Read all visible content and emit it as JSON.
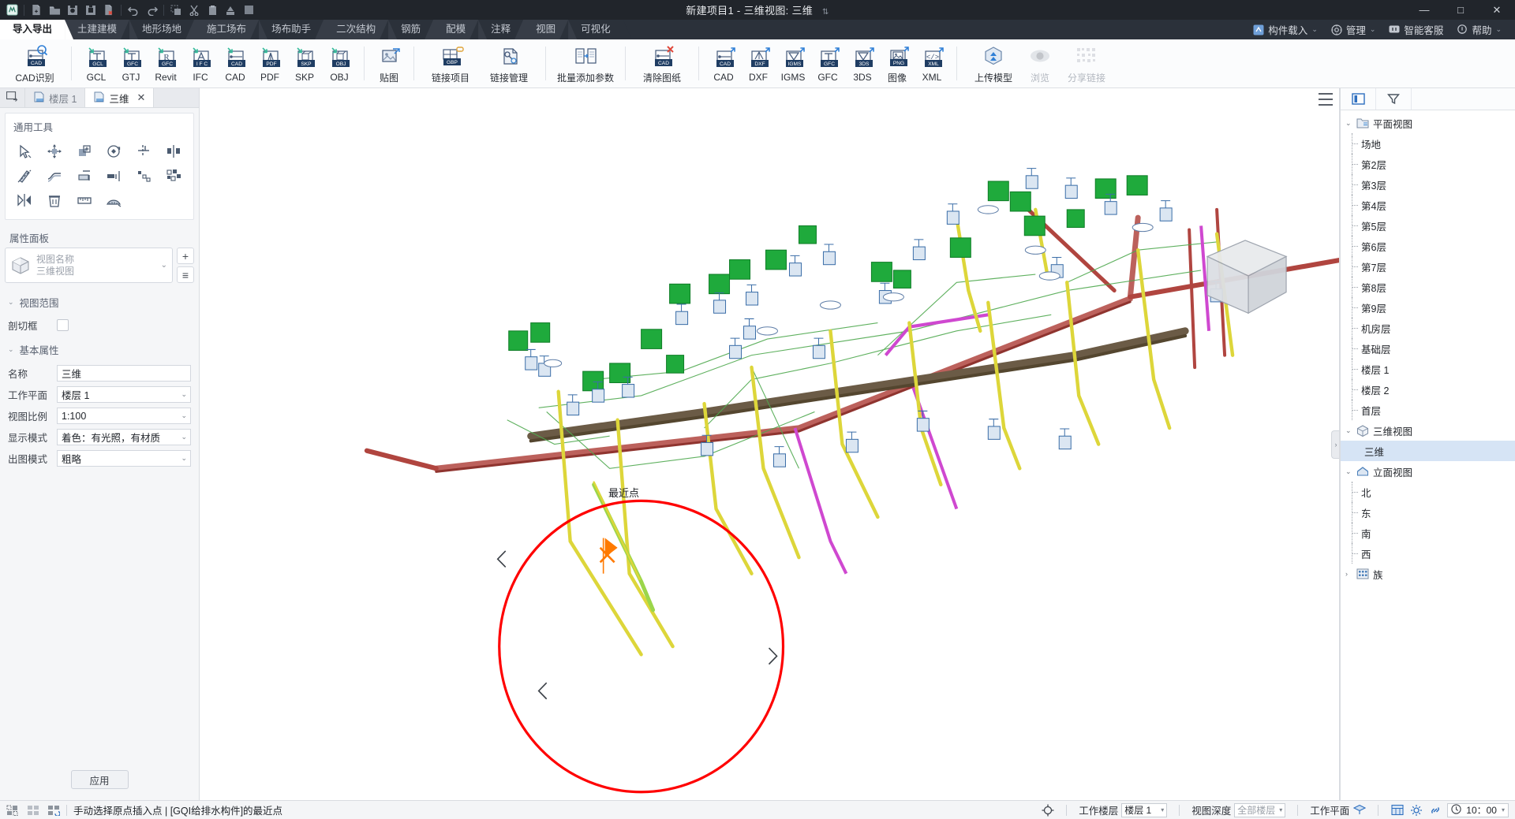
{
  "window": {
    "title": "新建项目1 - 三维视图: 三维",
    "minimize": "—",
    "maximize": "□",
    "close": "✕"
  },
  "quick_access": [
    {
      "name": "app-logo-icon",
      "label": "M"
    },
    {
      "name": "new-file-icon",
      "label": "新建"
    },
    {
      "name": "open-folder-icon",
      "label": "打开"
    },
    {
      "name": "save-icon",
      "label": "保存"
    },
    {
      "name": "save-as-icon",
      "label": "另存为"
    },
    {
      "name": "close-file-icon",
      "label": "关闭"
    },
    {
      "name": "undo-icon",
      "label": "撤销"
    },
    {
      "name": "redo-icon",
      "label": "恢复"
    },
    {
      "name": "copy-icon",
      "label": "复制"
    },
    {
      "name": "cut-icon",
      "label": "剪切"
    },
    {
      "name": "paste-icon",
      "label": "粘贴"
    },
    {
      "name": "delete-icon",
      "label": "删除"
    },
    {
      "name": "block-icon",
      "label": "构件"
    }
  ],
  "ribbon_tabs": [
    {
      "label": "导入导出",
      "selected": true
    },
    {
      "label": "土建建模",
      "selected": false
    },
    {
      "label": "地形场地",
      "selected": false
    },
    {
      "label": "施工场布",
      "selected": false
    },
    {
      "label": "场布助手",
      "selected": false
    },
    {
      "label": "二次结构",
      "selected": false
    },
    {
      "label": "钢筋",
      "selected": false
    },
    {
      "label": "配模",
      "selected": false
    },
    {
      "label": "注释",
      "selected": false
    },
    {
      "label": "视图",
      "selected": false
    },
    {
      "label": "可视化",
      "selected": false
    }
  ],
  "tabbar_right": [
    {
      "label": "构件载入",
      "icon": "component-load-icon",
      "has_caret": true
    },
    {
      "label": "管理",
      "icon": "gear-icon",
      "has_caret": true
    },
    {
      "label": "智能客服",
      "icon": "chat-icon",
      "has_caret": false
    },
    {
      "label": "帮助",
      "icon": "lightbulb-icon",
      "has_caret": true
    }
  ],
  "ribbon": {
    "groups": [
      {
        "name": "cad-recognize",
        "buttons": [
          {
            "label": "CAD识别",
            "icon": "cad-search-icon",
            "disabled": false,
            "wide": true
          }
        ]
      },
      {
        "name": "import",
        "buttons": [
          {
            "label": "GCL",
            "icon": "import-gcl-icon",
            "disabled": false
          },
          {
            "label": "GTJ",
            "icon": "import-gfc-icon",
            "disabled": false
          },
          {
            "label": "Revit",
            "icon": "import-gfc-r-icon",
            "disabled": false
          },
          {
            "label": "IFC",
            "icon": "import-ifc-icon",
            "disabled": false
          },
          {
            "label": "CAD",
            "icon": "import-cad-icon",
            "disabled": false
          },
          {
            "label": "PDF",
            "icon": "import-pdf-icon",
            "disabled": false
          },
          {
            "label": "SKP",
            "icon": "import-skp-icon",
            "disabled": false
          },
          {
            "label": "OBJ",
            "icon": "import-obj-icon",
            "disabled": false
          }
        ]
      },
      {
        "name": "texture",
        "buttons": [
          {
            "label": "贴图",
            "icon": "image-stack-icon",
            "disabled": false
          }
        ]
      },
      {
        "name": "link",
        "buttons": [
          {
            "label": "链接项目",
            "icon": "gbp-link-icon",
            "disabled": false,
            "wide": true
          },
          {
            "label": "链接管理",
            "icon": "link-manage-icon",
            "disabled": false,
            "wide": true
          }
        ]
      },
      {
        "name": "params",
        "buttons": [
          {
            "label": "批量添加参数",
            "icon": "batch-param-icon",
            "disabled": false,
            "wide": true
          }
        ]
      },
      {
        "name": "clear",
        "buttons": [
          {
            "label": "清除图纸",
            "icon": "cad-clear-icon",
            "disabled": false,
            "wide": true
          }
        ]
      },
      {
        "name": "export",
        "buttons": [
          {
            "label": "CAD",
            "icon": "export-cad-icon",
            "disabled": false
          },
          {
            "label": "DXF",
            "icon": "export-dxf-icon",
            "disabled": false
          },
          {
            "label": "IGMS",
            "icon": "export-igms-icon",
            "disabled": false
          },
          {
            "label": "GFC",
            "icon": "export-gfc-icon",
            "disabled": false
          },
          {
            "label": "3DS",
            "icon": "export-3ds-icon",
            "disabled": false
          },
          {
            "label": "图像",
            "icon": "export-png-icon",
            "disabled": false
          },
          {
            "label": "XML",
            "icon": "export-xml-icon",
            "disabled": false
          }
        ]
      },
      {
        "name": "cloud",
        "buttons": [
          {
            "label": "上传模型",
            "icon": "upload-model-icon",
            "disabled": false,
            "wide": true
          },
          {
            "label": "浏览",
            "icon": "eye-icon",
            "disabled": true
          },
          {
            "label": "分享链接",
            "icon": "qr-share-icon",
            "disabled": true,
            "wide": true
          }
        ]
      }
    ]
  },
  "doc_tabs": [
    {
      "label": "",
      "icon": "new-view-tab-icon",
      "active": false,
      "closable": false
    },
    {
      "label": "楼层 1",
      "icon": "plan-view-icon",
      "active": false,
      "closable": false
    },
    {
      "label": "三维",
      "icon": "3d-view-icon",
      "active": true,
      "closable": true
    }
  ],
  "left_panel": {
    "tools_title": "通用工具",
    "tools": [
      {
        "name": "select-tool",
        "label": "选择"
      },
      {
        "name": "move-tool",
        "label": "移动"
      },
      {
        "name": "copy-tool",
        "label": "复制"
      },
      {
        "name": "rotate-tool",
        "label": "旋转"
      },
      {
        "name": "trim-tool",
        "label": "修剪"
      },
      {
        "name": "align-tool",
        "label": "对齐"
      },
      {
        "name": "mirror-tool",
        "label": "镜像"
      },
      {
        "name": "offset-tool",
        "label": "偏移"
      },
      {
        "name": "split-tool",
        "label": "拆分"
      },
      {
        "name": "extend-tool",
        "label": "延伸"
      },
      {
        "name": "array-tool",
        "label": "阵列"
      },
      {
        "name": "group-tool",
        "label": "成组"
      },
      {
        "name": "flip-tool",
        "label": "翻转"
      },
      {
        "name": "delete-tool",
        "label": "删除"
      },
      {
        "name": "measure-tool",
        "label": "测量"
      },
      {
        "name": "protractor-tool",
        "label": "角度"
      }
    ],
    "props_title": "属性面板",
    "view_selector": {
      "placeholder": "视图名称",
      "subtitle": "三维视图",
      "add_label": "+",
      "edit_label": "≡"
    },
    "section_view_range": "视图范围",
    "clip_box_label": "剖切框",
    "clip_box_checked": false,
    "section_basic": "基本属性",
    "properties": [
      {
        "key": "名称",
        "value": "三维",
        "dropdown": false
      },
      {
        "key": "工作平面",
        "value": "楼层 1",
        "dropdown": true
      },
      {
        "key": "视图比例",
        "value": "1:100",
        "dropdown": true
      },
      {
        "key": "显示模式",
        "value": "着色：有光照，有材质",
        "dropdown": true
      },
      {
        "key": "出图模式",
        "value": "粗略",
        "dropdown": true
      }
    ],
    "apply_label": "应用"
  },
  "canvas": {
    "annotation_label": "最近点",
    "highlight_circle_color": "#ff0000",
    "cursor_marker_color": "#ff7a00",
    "hamburger_name": "canvas-menu-icon",
    "collapse_name": "panel-collapse-handle"
  },
  "right_panel": {
    "tabs": [
      {
        "name": "project-browser-tab",
        "icon": "panel-icon",
        "active": true
      },
      {
        "name": "filter-tab",
        "icon": "funnel-icon",
        "active": false
      }
    ],
    "tree": [
      {
        "label": "平面视图",
        "icon": "plan-folder-icon",
        "expanded": true,
        "chev": "⌄",
        "children": [
          "场地",
          "第2层",
          "第3层",
          "第4层",
          "第5层",
          "第6层",
          "第7层",
          "第8层",
          "第9层",
          "机房层",
          "基础层",
          "楼层 1",
          "楼层 2",
          "首层"
        ]
      },
      {
        "label": "三维视图",
        "icon": "cube-icon",
        "expanded": true,
        "chev": "⌄",
        "children": [
          "三维"
        ],
        "selected_child": "三维"
      },
      {
        "label": "立面视图",
        "icon": "elevation-icon",
        "expanded": true,
        "chev": "⌄",
        "children": [
          "北",
          "东",
          "南",
          "西"
        ]
      },
      {
        "label": "族",
        "icon": "family-icon",
        "expanded": false,
        "chev": "›",
        "children": []
      }
    ]
  },
  "statusbar": {
    "left_icons": [
      {
        "name": "selection-mode-icon"
      },
      {
        "name": "grid-mode-icon"
      },
      {
        "name": "reset-mode-icon"
      }
    ],
    "message": "手动选择原点插入点 | [GQI给排水构件]的最近点",
    "right": {
      "target_icon": "crosshair-icon",
      "work_floor_label": "工作楼层",
      "work_floor_value": "楼层 1",
      "view_depth_label": "视图深度",
      "view_depth_value": "全部楼层",
      "work_plane_label": "工作平面",
      "work_plane_icon": "work-plane-icon",
      "icons": [
        {
          "name": "table-icon"
        },
        {
          "name": "settings-gear-icon"
        },
        {
          "name": "link-status-icon"
        },
        {
          "name": "clock-icon"
        }
      ],
      "time_value": "10：00"
    }
  }
}
